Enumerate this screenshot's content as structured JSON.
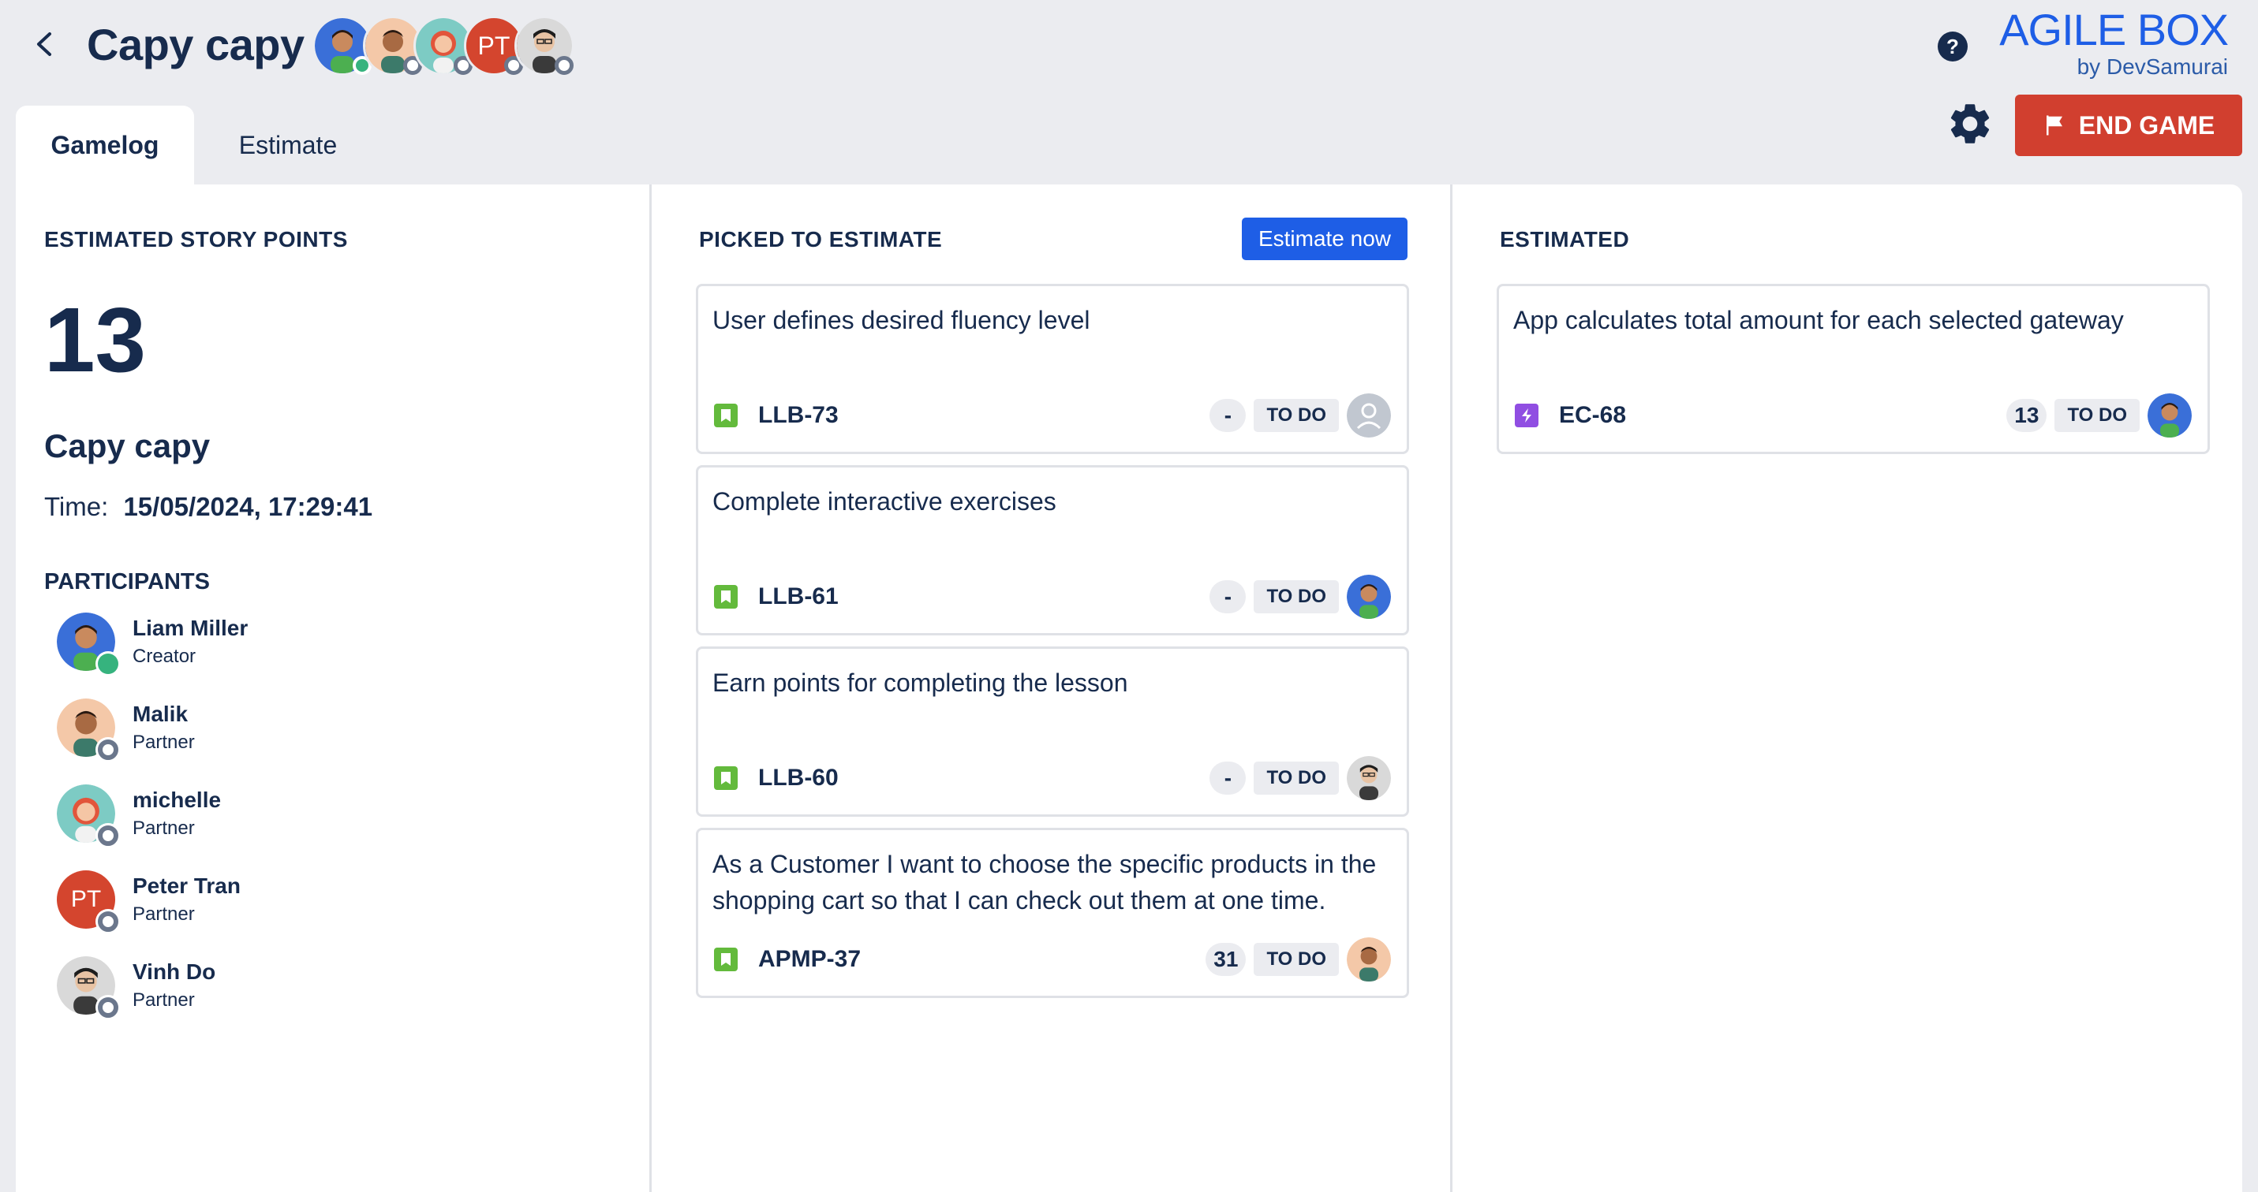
{
  "header": {
    "title": "Capy capy",
    "help_label": "?",
    "brand_title": "AGILE BOX",
    "brand_subtitle": "by DevSamurai",
    "end_game_label": "END GAME",
    "avatar_initials": "PT"
  },
  "tabs": [
    {
      "label": "Gamelog",
      "active": true
    },
    {
      "label": "Estimate",
      "active": false
    }
  ],
  "summary": {
    "title": "ESTIMATED STORY POINTS",
    "points": "13",
    "session_name": "Capy capy",
    "time_label": "Time:",
    "time_value": "15/05/2024, 17:29:41",
    "participants_title": "PARTICIPANTS",
    "participants": [
      {
        "name": "Liam Miller",
        "role": "Creator",
        "status": "online",
        "avatar": "blue-man"
      },
      {
        "name": "Malik",
        "role": "Partner",
        "status": "offline",
        "avatar": "tan-man"
      },
      {
        "name": "michelle",
        "role": "Partner",
        "status": "offline",
        "avatar": "red-hair-woman"
      },
      {
        "name": "Peter Tran",
        "role": "Partner",
        "status": "offline",
        "avatar": "initials",
        "initials": "PT"
      },
      {
        "name": "Vinh Do",
        "role": "Partner",
        "status": "offline",
        "avatar": "glasses-man"
      }
    ]
  },
  "picked": {
    "title": "PICKED TO ESTIMATE",
    "estimate_now_label": "Estimate now",
    "cards": [
      {
        "summary": "User defines desired fluency level",
        "key": "LLB-73",
        "type": "story",
        "points": "-",
        "status": "TO DO",
        "assignee": "unassigned"
      },
      {
        "summary": "Complete interactive exercises",
        "key": "LLB-61",
        "type": "story",
        "points": "-",
        "status": "TO DO",
        "assignee": "blue-man"
      },
      {
        "summary": "Earn points for completing the lesson",
        "key": "LLB-60",
        "type": "story",
        "points": "-",
        "status": "TO DO",
        "assignee": "glasses-man"
      },
      {
        "summary": "As a Customer I want to choose the specific products in the shopping cart so that I can check out them at one time.",
        "key": "APMP-37",
        "type": "story",
        "points": "31",
        "status": "TO DO",
        "assignee": "tan-man"
      }
    ]
  },
  "estimated": {
    "title": "ESTIMATED",
    "cards": [
      {
        "summary": "App calculates total amount for each selected gateway",
        "key": "EC-68",
        "type": "epic",
        "points": "13",
        "status": "TO DO",
        "assignee": "blue-man"
      }
    ]
  },
  "colors": {
    "accent_blue": "#1e5ee6",
    "end_game_red": "#d13f2f",
    "story_green": "#63ba3c",
    "epic_purple": "#904ee2",
    "online_green": "#36b37e",
    "text_dark": "#172b4d"
  }
}
